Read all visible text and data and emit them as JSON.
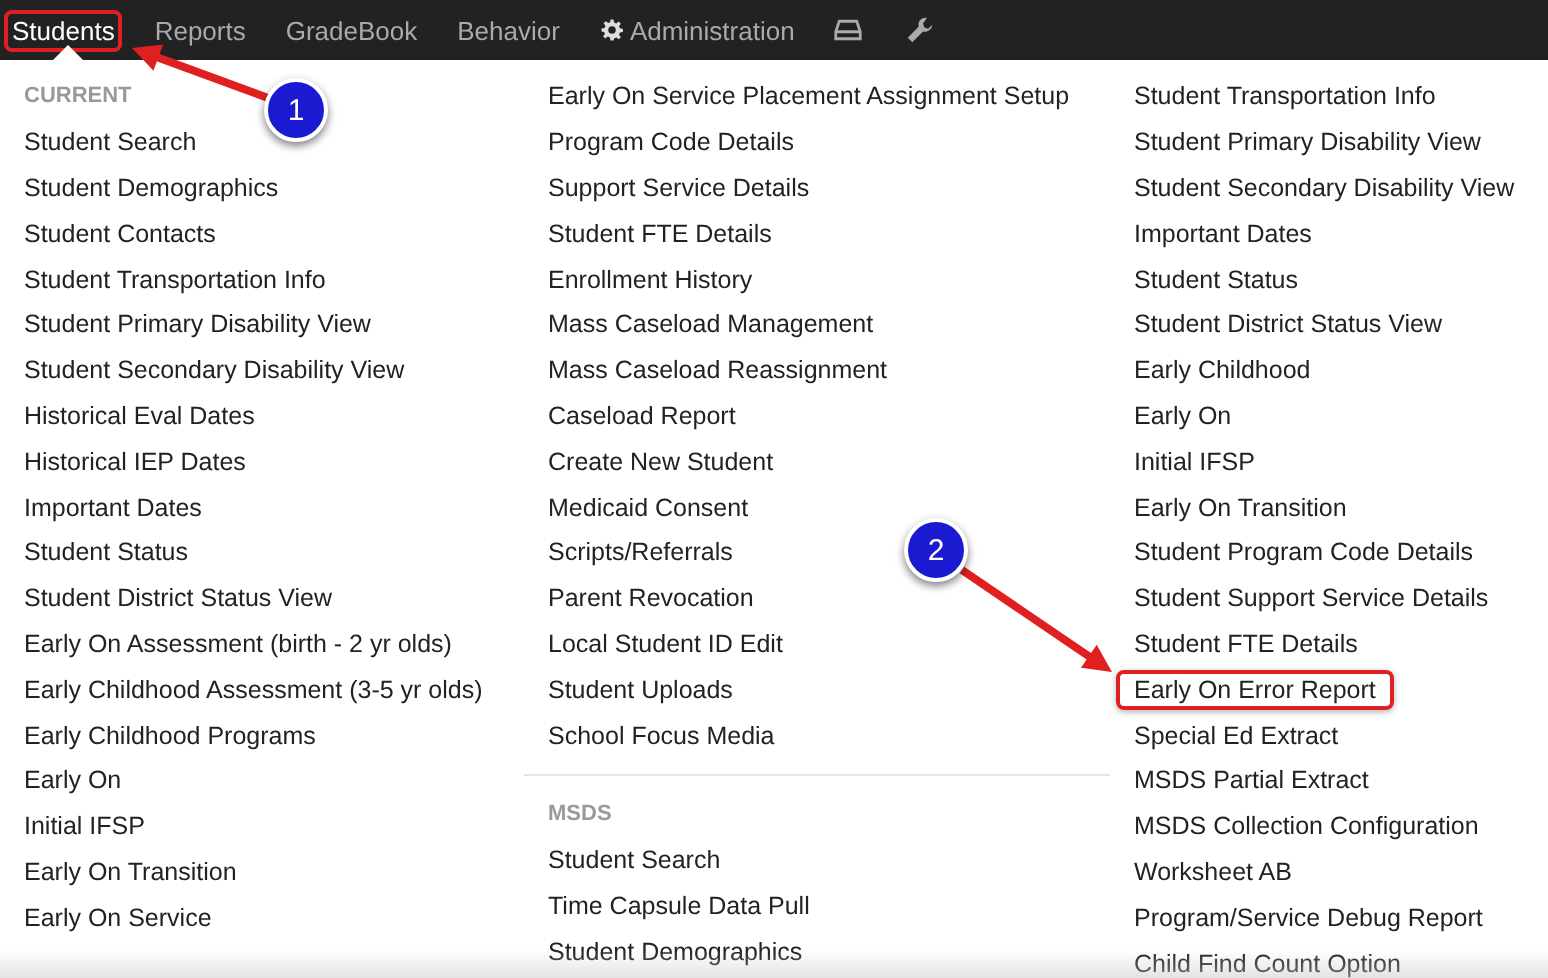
{
  "nav": [
    {
      "kind": "text",
      "label": "Students",
      "selected": true,
      "highlighted": true
    },
    {
      "kind": "text",
      "label": "Reports",
      "selected": false,
      "highlighted": false
    },
    {
      "kind": "text",
      "label": "GradeBook",
      "selected": false,
      "highlighted": false
    },
    {
      "kind": "text",
      "label": "Behavior",
      "selected": false,
      "highlighted": false
    },
    {
      "kind": "gear",
      "label": "Administration",
      "selected": false,
      "highlighted": false
    },
    {
      "kind": "tray",
      "selected": false,
      "highlighted": false
    },
    {
      "kind": "wrench",
      "selected": false,
      "highlighted": false
    }
  ],
  "columns": [
    {
      "sections": [
        {
          "heading": "CURRENT",
          "items": [
            {
              "label": "Student Search",
              "highlighted": false
            },
            {
              "label": "Student Demographics",
              "highlighted": false
            },
            {
              "label": "Student Contacts",
              "highlighted": false
            },
            {
              "label": "Student Transportation Info",
              "highlighted": false
            },
            {
              "label": "Student Primary Disability View",
              "highlighted": false
            },
            {
              "label": "Student Secondary Disability View",
              "highlighted": false
            },
            {
              "label": "Historical Eval Dates",
              "highlighted": false
            },
            {
              "label": "Historical IEP Dates",
              "highlighted": false
            },
            {
              "label": "Important Dates",
              "highlighted": false
            },
            {
              "label": "Student Status",
              "highlighted": false
            },
            {
              "label": "Student District Status View",
              "highlighted": false
            },
            {
              "label": "Early On Assessment (birth - 2 yr olds)",
              "highlighted": false
            },
            {
              "label": "Early Childhood Assessment (3-5 yr olds)",
              "highlighted": false
            },
            {
              "label": "Early Childhood Programs",
              "highlighted": false
            },
            {
              "label": "Early On",
              "highlighted": false
            },
            {
              "label": "Initial IFSP",
              "highlighted": false
            },
            {
              "label": "Early On Transition",
              "highlighted": false
            },
            {
              "label": "Early On Service",
              "highlighted": false
            }
          ]
        }
      ]
    },
    {
      "sections": [
        {
          "items": [
            {
              "label": "Early On Service Placement Assignment Setup",
              "highlighted": false
            },
            {
              "label": "Program Code Details",
              "highlighted": false
            },
            {
              "label": "Support Service Details",
              "highlighted": false
            },
            {
              "label": "Student FTE Details",
              "highlighted": false
            },
            {
              "label": "Enrollment History",
              "highlighted": false
            },
            {
              "label": "Mass Caseload Management",
              "highlighted": false
            },
            {
              "label": "Mass Caseload Reassignment",
              "highlighted": false
            },
            {
              "label": "Caseload Report",
              "highlighted": false
            },
            {
              "label": "Create New Student",
              "highlighted": false
            },
            {
              "label": "Medicaid Consent",
              "highlighted": false
            },
            {
              "label": "Scripts/Referrals",
              "highlighted": false
            },
            {
              "label": "Parent Revocation",
              "highlighted": false
            },
            {
              "label": "Local Student ID Edit",
              "highlighted": false
            },
            {
              "label": "Student Uploads",
              "highlighted": false
            },
            {
              "label": "School Focus Media",
              "highlighted": false
            }
          ]
        },
        {
          "heading": "MSDS",
          "items": [
            {
              "label": "Student Search",
              "highlighted": false
            },
            {
              "label": "Time Capsule Data Pull",
              "highlighted": false
            },
            {
              "label": "Student Demographics",
              "highlighted": false
            }
          ]
        }
      ]
    },
    {
      "sections": [
        {
          "items": [
            {
              "label": "Student Transportation Info",
              "highlighted": false
            },
            {
              "label": "Student Primary Disability View",
              "highlighted": false
            },
            {
              "label": "Student Secondary Disability View",
              "highlighted": false
            },
            {
              "label": "Important Dates",
              "highlighted": false
            },
            {
              "label": "Student Status",
              "highlighted": false
            },
            {
              "label": "Student District Status View",
              "highlighted": false
            },
            {
              "label": "Early Childhood",
              "highlighted": false
            },
            {
              "label": "Early On",
              "highlighted": false
            },
            {
              "label": "Initial IFSP",
              "highlighted": false
            },
            {
              "label": "Early On Transition",
              "highlighted": false
            },
            {
              "label": "Student Program Code Details",
              "highlighted": false
            },
            {
              "label": "Student Support Service Details",
              "highlighted": false
            },
            {
              "label": "Student FTE Details",
              "highlighted": false
            },
            {
              "label": "Early On Error Report",
              "highlighted": true
            },
            {
              "label": "Special Ed Extract",
              "highlighted": false
            },
            {
              "label": "MSDS Partial Extract",
              "highlighted": false
            },
            {
              "label": "MSDS Collection Configuration",
              "highlighted": false
            },
            {
              "label": "Worksheet AB",
              "highlighted": false
            },
            {
              "label": "Program/Service Debug Report",
              "highlighted": false
            },
            {
              "label": "Child Find Count Option",
              "highlighted": false
            }
          ]
        }
      ]
    }
  ],
  "callouts": [
    {
      "number": "1"
    },
    {
      "number": "2"
    }
  ]
}
